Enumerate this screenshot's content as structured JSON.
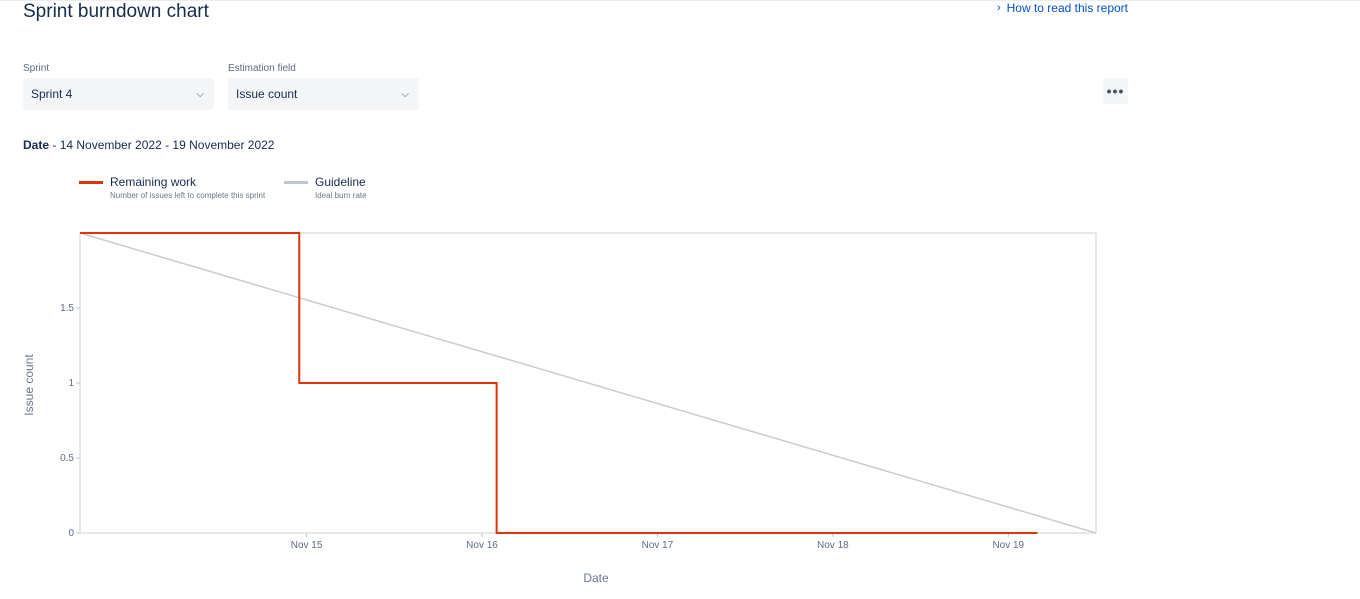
{
  "header": {
    "title": "Sprint burndown chart",
    "help_link": "How to read this report"
  },
  "filters": {
    "sprint_label": "Sprint",
    "sprint_value": "Sprint 4",
    "estimation_label": "Estimation field",
    "estimation_value": "Issue count",
    "more_icon": "more-horizontal-icon"
  },
  "date_range": {
    "label": "Date",
    "separator": " - ",
    "value": "14 November 2022 - 19 November 2022"
  },
  "legend": [
    {
      "name": "Remaining work",
      "description": "Number of issues left to complete this sprint",
      "color": "#de350b"
    },
    {
      "name": "Guideline",
      "description": "Ideal burn rate",
      "color": "#c1c7d0"
    }
  ],
  "chart_data": {
    "type": "line",
    "xlabel": "Date",
    "ylabel": "Issue count",
    "x_ticks": [
      "Nov 15",
      "Nov 16",
      "Nov 17",
      "Nov 18",
      "Nov 19"
    ],
    "y_ticks": [
      0,
      0.5,
      1,
      1.5
    ],
    "xlim": [
      "2022-11-14T05:00",
      "2022-11-20T00:00"
    ],
    "ylim": [
      0,
      2
    ],
    "series": [
      {
        "name": "Remaining work",
        "color": "#de350b",
        "step": true,
        "points": [
          {
            "x": "2022-11-14T05:00",
            "y": 2
          },
          {
            "x": "2022-11-15T11:00",
            "y": 1
          },
          {
            "x": "2022-11-16T14:00",
            "y": 0
          },
          {
            "x": "2022-11-19T16:00",
            "y": 0
          }
        ]
      },
      {
        "name": "Guideline",
        "color": "#cccccc",
        "step": false,
        "points": [
          {
            "x": "2022-11-14T05:00",
            "y": 2
          },
          {
            "x": "2022-11-20T00:00",
            "y": 0
          }
        ]
      }
    ]
  }
}
